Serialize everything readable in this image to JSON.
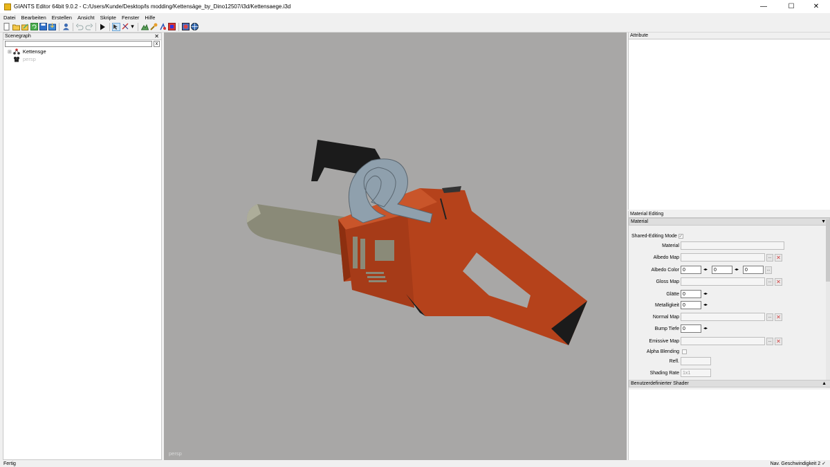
{
  "window": {
    "title": "GIANTS Editor 64bit 9.0.2 - C:/Users/Kunde/Desktop/ls modding/Kettensäge_by_Dino12507/i3d/Kettensaege.i3d",
    "minimize": "—",
    "maximize": "☐",
    "close": "✕"
  },
  "menu": [
    "Datei",
    "Bearbeiten",
    "Erstellen",
    "Ansicht",
    "Skripte",
    "Fenster",
    "Hilfe"
  ],
  "toolbar": {
    "icons": [
      "new-file-icon",
      "open-icon",
      "edit-icon",
      "refresh-icon",
      "save-icon",
      "import-icon",
      "user-icon",
      "undo-icon",
      "redo-icon",
      "play-icon",
      "select-icon",
      "transform-icon",
      "terrain-icon",
      "paint-icon",
      "foliage-icon",
      "material-icon",
      "globe-icon"
    ]
  },
  "scenegraph": {
    "title": "Scenegraph",
    "close": "✕",
    "search_clear": "x",
    "items": [
      {
        "label": "Kettensge",
        "icon": "transform-group-icon",
        "expand": "⊞"
      },
      {
        "label": "persp",
        "icon": "camera-icon"
      }
    ]
  },
  "viewport": {
    "camera_label": "persp",
    "background": "#a8a7a6"
  },
  "attribute": {
    "title": "Attribute"
  },
  "material_editing": {
    "title": "Material Editing",
    "material_section": "Material",
    "material_section_arrow": "▼",
    "shared_editing_label": "Shared-Editing Mode",
    "shared_editing_check": "✓",
    "material_label": "Material",
    "albedo_map_label": "Albedo Map",
    "albedo_color_label": "Albedo Color",
    "albedo_color_values": [
      "0",
      "0",
      "0"
    ],
    "gloss_map_label": "Gloss Map",
    "glaette_label": "Glätte",
    "glaette_value": "0",
    "metallic_label": "Metalligkeit",
    "metallic_value": "0",
    "normal_map_label": "Normal Map",
    "bump_label": "Bump Tiefe",
    "bump_value": "0",
    "emissive_label": "Emissive Map",
    "alpha_label": "Alpha Blending",
    "refl_label": "Refl.",
    "shading_rate_label": "Shading Rate",
    "shading_rate_value": "1x1",
    "browse": "...",
    "clear": "✕",
    "spin": "◂▸",
    "shader_section": "Benutzerdefinierter Shader",
    "shader_section_arrow": "▲"
  },
  "status": {
    "left": "Fertig",
    "right": "Nav. Geschwindigkeit 2  ✓"
  },
  "colors": {
    "chainsaw_body": "#b5421b",
    "chainsaw_dark": "#8d2f10",
    "bar": "#8a8a78",
    "handle_metal": "#8fa0ad"
  }
}
